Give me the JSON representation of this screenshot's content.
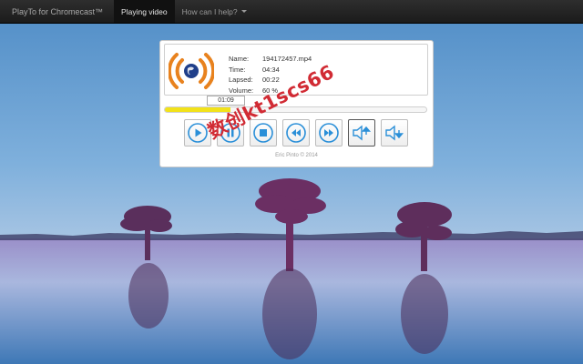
{
  "navbar": {
    "brand": "PlayTo for Chromecast™",
    "items": [
      {
        "label": "Playing video",
        "active": true
      },
      {
        "label": "How can I help?",
        "active": false
      }
    ]
  },
  "player": {
    "info": {
      "name_label": "Name:",
      "name_value": "194172457.mp4",
      "time_label": "Time:",
      "time_value": "04:34",
      "lapsed_label": "Lapsed:",
      "lapsed_value": "00:22",
      "volume_label": "Volume:",
      "volume_value": "60 %"
    },
    "position_badge": "01:09",
    "progress_fraction": 0.25,
    "controls": [
      {
        "name": "play-button",
        "icon": "play-icon"
      },
      {
        "name": "pause-button",
        "icon": "pause-icon"
      },
      {
        "name": "stop-button",
        "icon": "stop-icon"
      },
      {
        "name": "rewind-button",
        "icon": "rewind-icon"
      },
      {
        "name": "fast-forward-button",
        "icon": "fast-forward-icon"
      },
      {
        "name": "volume-up-button",
        "icon": "volume-up-icon"
      },
      {
        "name": "volume-down-button",
        "icon": "volume-down-icon"
      }
    ],
    "footer": "Eric Pinto © 2014"
  },
  "watermark": "数创kt1scs66",
  "colors": {
    "accent_blue": "#2a8fd8",
    "progress_yellow": "#f2e21a",
    "logo_orange": "#e8821e",
    "navbar_bg": "#222222"
  }
}
